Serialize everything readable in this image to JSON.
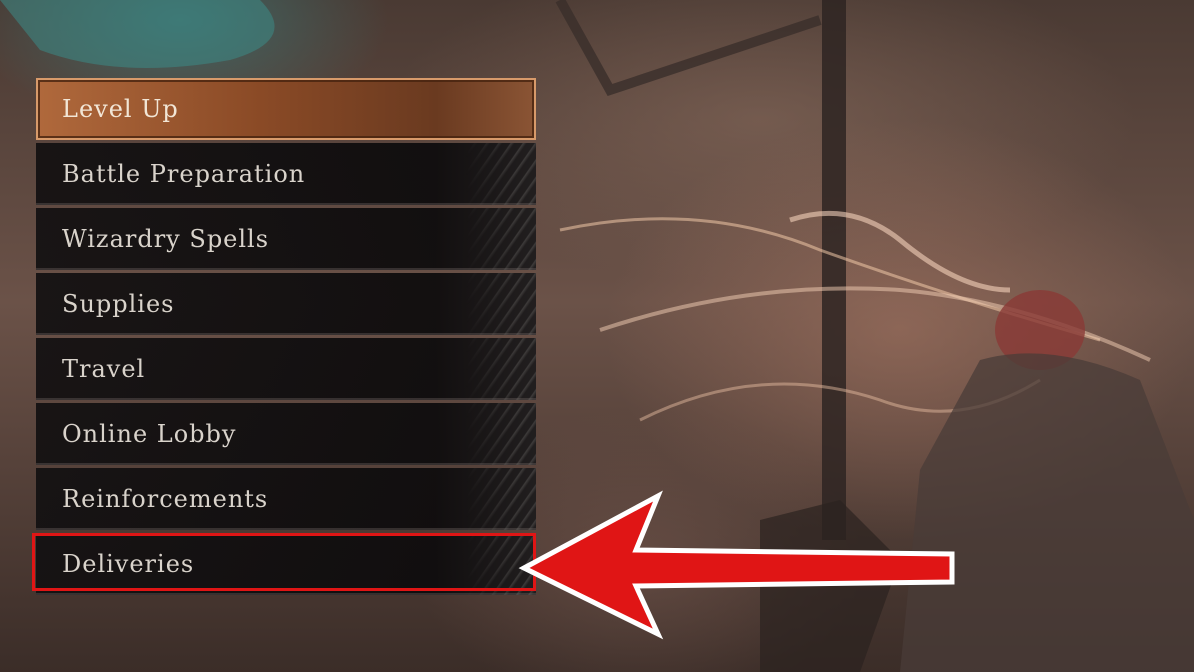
{
  "menu": {
    "items": [
      {
        "label": "Level Up",
        "selected": true
      },
      {
        "label": "Battle Preparation"
      },
      {
        "label": "Wizardry Spells"
      },
      {
        "label": "Supplies"
      },
      {
        "label": "Travel"
      },
      {
        "label": "Online Lobby"
      },
      {
        "label": "Reinforcements"
      },
      {
        "label": "Deliveries",
        "highlighted": true
      }
    ]
  },
  "annotation": {
    "arrow_color": "#e01515",
    "target_item": "Deliveries"
  },
  "colors": {
    "selected_item": "#a35f36",
    "item_background": "#121011",
    "label_text": "#d9d3cb"
  }
}
